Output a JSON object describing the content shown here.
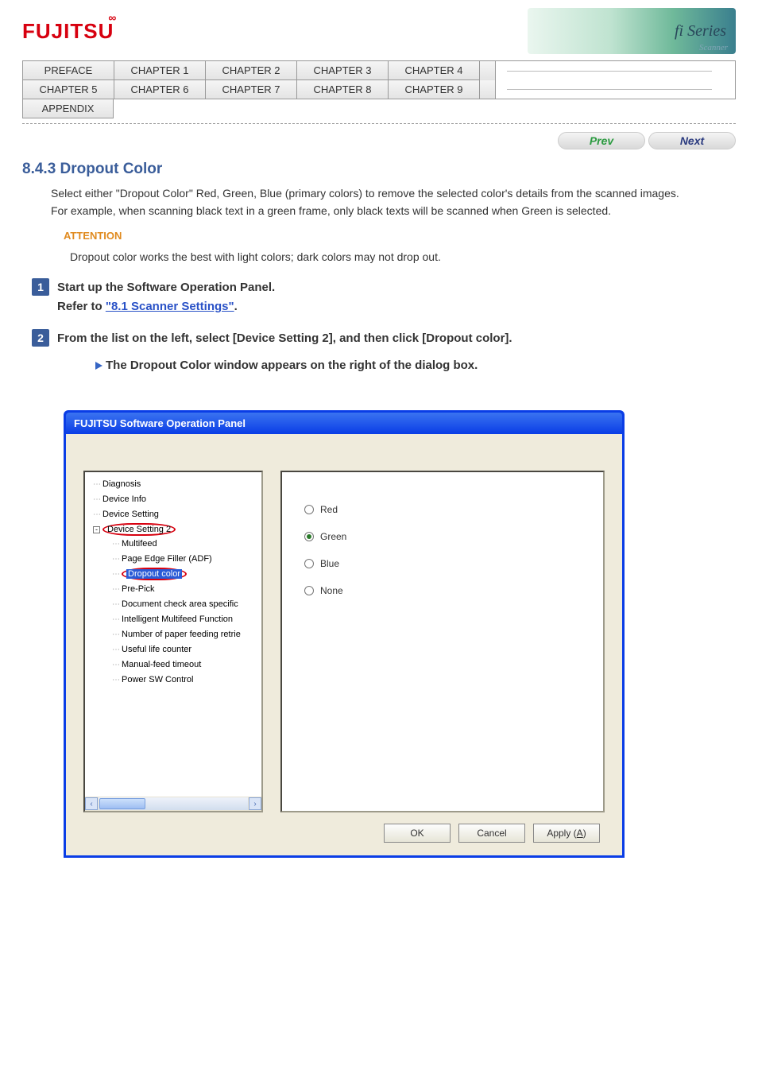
{
  "brand": {
    "logo_text": "FUJITSU",
    "banner_label": "fi Series",
    "banner_sub": "Scanner"
  },
  "nav": {
    "row1": [
      "PREFACE",
      "CHAPTER 1",
      "CHAPTER 2",
      "CHAPTER 3",
      "CHAPTER 4"
    ],
    "row2": [
      "CHAPTER 5",
      "CHAPTER 6",
      "CHAPTER 7",
      "CHAPTER 8",
      "CHAPTER 9"
    ],
    "row3": [
      "APPENDIX"
    ]
  },
  "pagenav": {
    "prev": "Prev",
    "next": "Next"
  },
  "section": {
    "number": "8.4.3",
    "title": "Dropout Color",
    "intro_a": "Select either ",
    "intro_quote": "\"Dropout Color\"",
    "intro_b": " Red, Green, Blue (primary colors) to remove the selected color's details from the scanned images. For example, when scanning black text in a green frame, only black texts will be scanned when Green is selected.",
    "attention_label": "ATTENTION",
    "attention_body": "Dropout color works the best with light colors; dark colors may not drop out."
  },
  "steps": {
    "s1_a": "Start up the Software Operation Panel.",
    "s1_b": "Refer to ",
    "s1_link": "\"8.1 Scanner Settings\"",
    "s1_c": ".",
    "s2": "From the list on the left, select [Device Setting 2], and then click [Dropout color].",
    "arrow_msg": "The Dropout Color window appears on the right of the dialog box."
  },
  "dialog": {
    "title": "FUJITSU Software Operation Panel",
    "tree_lvl1": [
      "Diagnosis",
      "Device Info",
      "Device Setting"
    ],
    "tree_expand": "Device Setting 2",
    "tree_lvl2": [
      "Multifeed",
      "Page Edge Filler (ADF)",
      "Dropout color",
      "Pre-Pick",
      "Document check area specific",
      "Intelligent Multifeed Function",
      "Number of paper feeding retrie",
      "Useful life counter",
      "Manual-feed timeout",
      "Power SW Control"
    ],
    "highlighted_child": "Dropout color",
    "radios": [
      "Red",
      "Green",
      "Blue",
      "None"
    ],
    "selected_radio": "Green",
    "buttons": {
      "ok": "OK",
      "cancel": "Cancel",
      "apply_pre": "Apply (",
      "apply_u": "A",
      "apply_post": ")"
    }
  }
}
